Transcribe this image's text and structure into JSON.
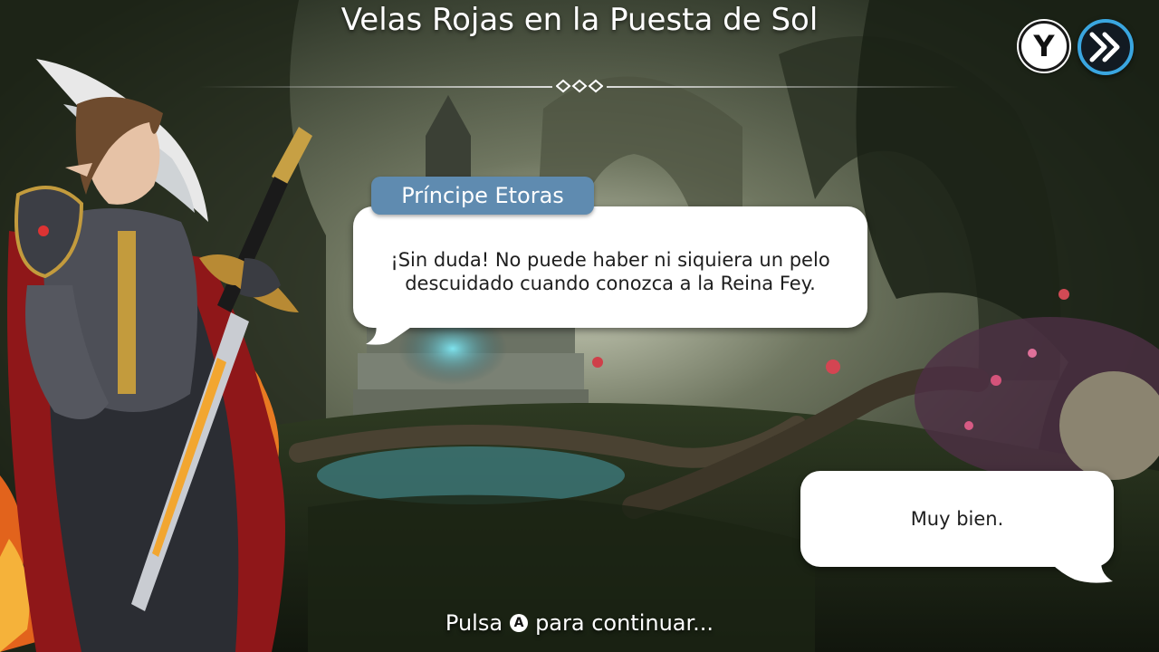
{
  "scene": {
    "title": "Velas Rojas en la Puesta de Sol"
  },
  "controls": {
    "log_button_label": "Y",
    "skip_icon": "double-chevron-right-icon"
  },
  "dialogue": {
    "speaker": "Príncipe Etoras",
    "line_1": "¡Sin duda! No puede haber ni siquiera un pelo",
    "line_2": "descuidado cuando conozca a la Reina Fey.",
    "reply": "Muy bien."
  },
  "prompt": {
    "before": "Pulsa",
    "button": "A",
    "after": "para continuar..."
  },
  "colors": {
    "name_tag": "#5f8bb0",
    "skip_ring": "#3aa6e0"
  }
}
